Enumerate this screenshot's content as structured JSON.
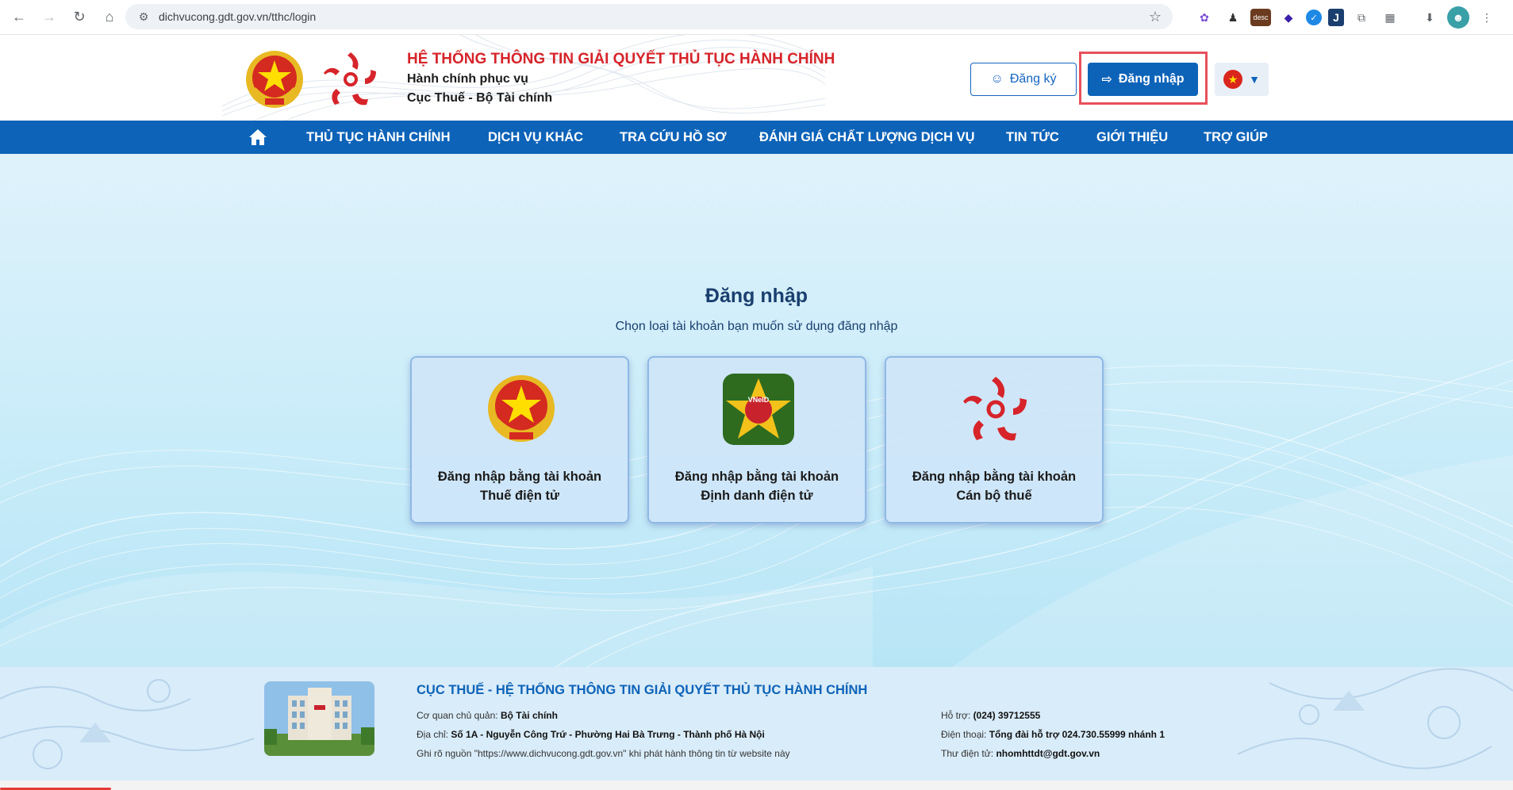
{
  "browser": {
    "url": "dichvucong.gdt.gov.vn/tthc/login",
    "extensions": [
      "flower-icon",
      "user-icon",
      "desc",
      "diamond-icon",
      "check-badge-icon",
      "j-icon",
      "copy-icon",
      "puzzle-icon"
    ]
  },
  "header": {
    "title": "HỆ THỐNG THÔNG TIN GIẢI QUYẾT THỦ TỤC HÀNH CHÍNH",
    "subtitle1": "Hành chính phục vụ",
    "subtitle2": "Cục Thuế - Bộ Tài chính",
    "register_label": "Đăng ký",
    "login_label": "Đăng nhập"
  },
  "nav": {
    "items": [
      "THỦ TỤC HÀNH CHÍNH",
      "DỊCH VỤ KHÁC",
      "TRA CỨU HỒ SƠ",
      "ĐÁNH GIÁ CHẤT LƯỢNG DỊCH VỤ",
      "TIN TỨC",
      "GIỚI THIỆU",
      "TRỢ GIÚP"
    ]
  },
  "login": {
    "title": "Đăng nhập",
    "subtitle": "Chọn loại tài khoản bạn muốn sử dụng đăng nhập",
    "cards": [
      {
        "line1": "Đăng nhập bằng tài khoản",
        "line2": "Thuế điện tử"
      },
      {
        "line1": "Đăng nhập bằng tài khoản",
        "line2": "Định danh điện tử"
      },
      {
        "line1": "Đăng nhập bằng tài khoản",
        "line2": "Cán bộ thuế"
      }
    ],
    "vneid_text": "VNeID"
  },
  "footer": {
    "title": "CỤC THUẾ - HỆ THỐNG THÔNG TIN GIẢI QUYẾT THỦ TỤC HÀNH CHÍNH",
    "agency_label": "Cơ quan chủ quản:",
    "agency_value": "Bộ Tài chính",
    "address_label": "Địa chỉ:",
    "address_value": "Số 1A - Nguyễn Công Trứ - Phường Hai Bà Trưng - Thành phố Hà Nội",
    "source_note": "Ghi rõ nguồn \"https://www.dichvucong.gdt.gov.vn\" khi phát hành thông tin từ website này",
    "support_label": "Hỗ trợ:",
    "support_value": "(024) 39712555",
    "phone_label": "Điện thoại:",
    "phone_value": "Tổng đài hỗ trợ 024.730.55999 nhánh 1",
    "email_label": "Thư điện tử:",
    "email_value": "nhomhttdt@gdt.gov.vn"
  },
  "colors": {
    "primary": "#0d63b8",
    "title_red": "#d6242a",
    "highlight": "#e8505b"
  }
}
